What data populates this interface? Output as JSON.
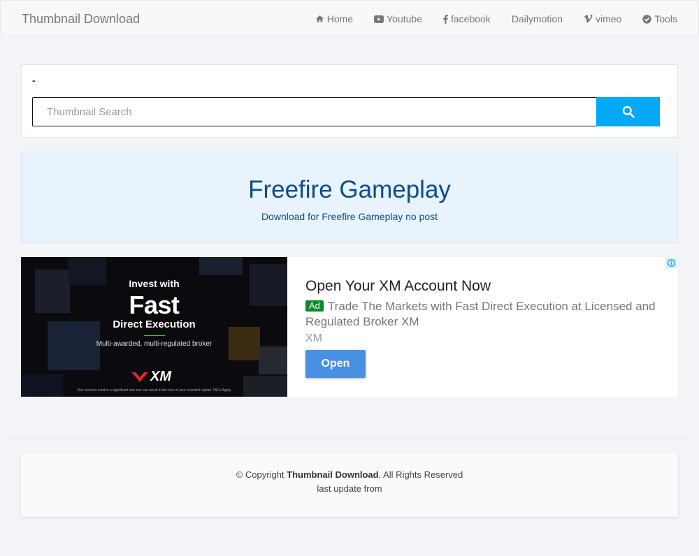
{
  "navbar": {
    "brand": "Thumbnail Download",
    "items": [
      {
        "label": "Home",
        "icon": "home-icon"
      },
      {
        "label": "Youtube",
        "icon": "youtube-icon"
      },
      {
        "label": "facebook",
        "icon": "facebook-icon"
      },
      {
        "label": "Dailymotion",
        "icon": ""
      },
      {
        "label": "vimeo",
        "icon": "vimeo-icon"
      },
      {
        "label": "Tools",
        "icon": "check-circle-icon"
      }
    ]
  },
  "search": {
    "label": "-",
    "placeholder": "Thumbnail Search",
    "value": "",
    "button_icon": "search-icon",
    "button_color": "#03a9f4"
  },
  "title": {
    "heading": "Freefire Gameplay",
    "subheading": "Download for Freefire Gameplay no post"
  },
  "ad": {
    "image_line1": "Invest with",
    "image_line2": "Fast",
    "image_line3": "Direct Execution",
    "image_line4": "Multi-awarded, multi-regulated broker",
    "image_logo": "XM",
    "image_disclaimer": "Our services involve a significant risk and can result in the loss of your invested capital. T&Cs Apply",
    "headline": "Open Your XM Account Now",
    "badge": "Ad",
    "description": "Trade The Markets with Fast Direct Execution at Licensed and Regulated Broker XM",
    "advertiser": "XM",
    "cta": "Open",
    "cta_color": "#4a90e2"
  },
  "footer": {
    "copyright_prefix": "© Copyright",
    "site_name": "Thumbnail Download",
    "copyright_suffix": ". All Rights Reserved",
    "last_update": "last update from"
  }
}
